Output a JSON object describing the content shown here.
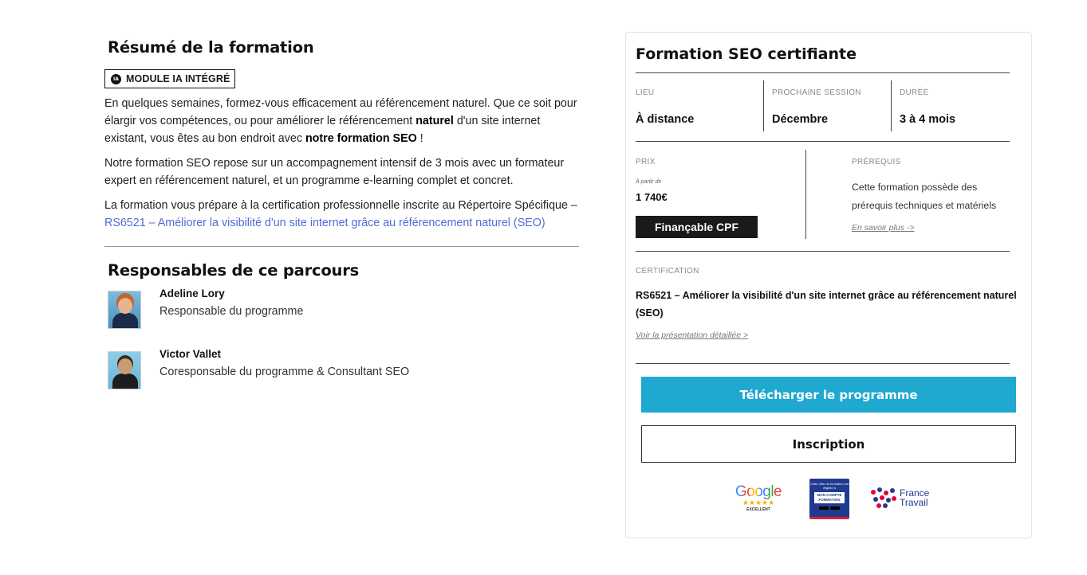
{
  "summary": {
    "title": "Résumé de la formation",
    "badge": "MODULE IA INTÉGRÉ",
    "badge_icon_text": "IA",
    "p1_a": "En quelques semaines, formez-vous efficacement au référencement naturel. Que ce soit pour élargir vos compétences, ou pour améliorer le référencement ",
    "p1_b": "naturel",
    "p1_c": " d'un site internet existant, vous êtes au bon endroit avec ",
    "p1_d": "notre formation SEO",
    "p1_e": " !",
    "p2": "Notre formation SEO repose sur un accompagnement intensif de 3 mois avec un formateur expert en référencement naturel, et un programme e-learning complet et concret.",
    "p3_a": "La formation vous prépare à la certification professionnelle inscrite au Répertoire Spécifique – ",
    "p3_link": "RS6521 – Améliorer la visibilité d'un site internet grâce au référencement naturel (SEO)"
  },
  "responsables": {
    "title": "Responsables de ce parcours",
    "people": [
      {
        "name": "Adeline Lory",
        "role": "Responsable du programme"
      },
      {
        "name": "Victor Vallet",
        "role": "Coresponsable du programme & Consultant SEO"
      }
    ]
  },
  "card": {
    "title": "Formation SEO certifiante",
    "lieu_label": "LIEU",
    "lieu_value": "À distance",
    "session_label": "PROCHAINE SESSION",
    "session_value": "Décembre",
    "duree_label": "DURÉE",
    "duree_value": "3 à 4 mois",
    "prix_label": "PRIX",
    "prix_from": "À partir de",
    "prix_value": "1 740€",
    "cpf_label": "Finançable CPF",
    "prereq_label": "PRÉREQUIS",
    "prereq_text": "Cette formation possède des prérequis techniques et matériels",
    "prereq_link": "En savoir plus ->",
    "cert_label": "CERTIFICATION",
    "cert_text": "RS6521 – Améliorer la visibilité d'un site internet grâce au référencement naturel (SEO)",
    "cert_link": "Voir la présentation détaillée >",
    "download_button": "Télécharger le programme",
    "inscription_button": "Inscription"
  },
  "logos": {
    "google_word": "Google",
    "google_stars": "★★★★★",
    "google_caption": "EXCELLENT",
    "mcf_top": "Cette offre de formation est éligible à",
    "mcf_main": "MON COMPTE FORMATION",
    "france_travail_line1": "France",
    "france_travail_line2": "Travail"
  },
  "colors": {
    "accent_blue": "#1fa8d0",
    "link_blue": "#4f6bd6",
    "cpf_bg": "#1a1a1a"
  }
}
